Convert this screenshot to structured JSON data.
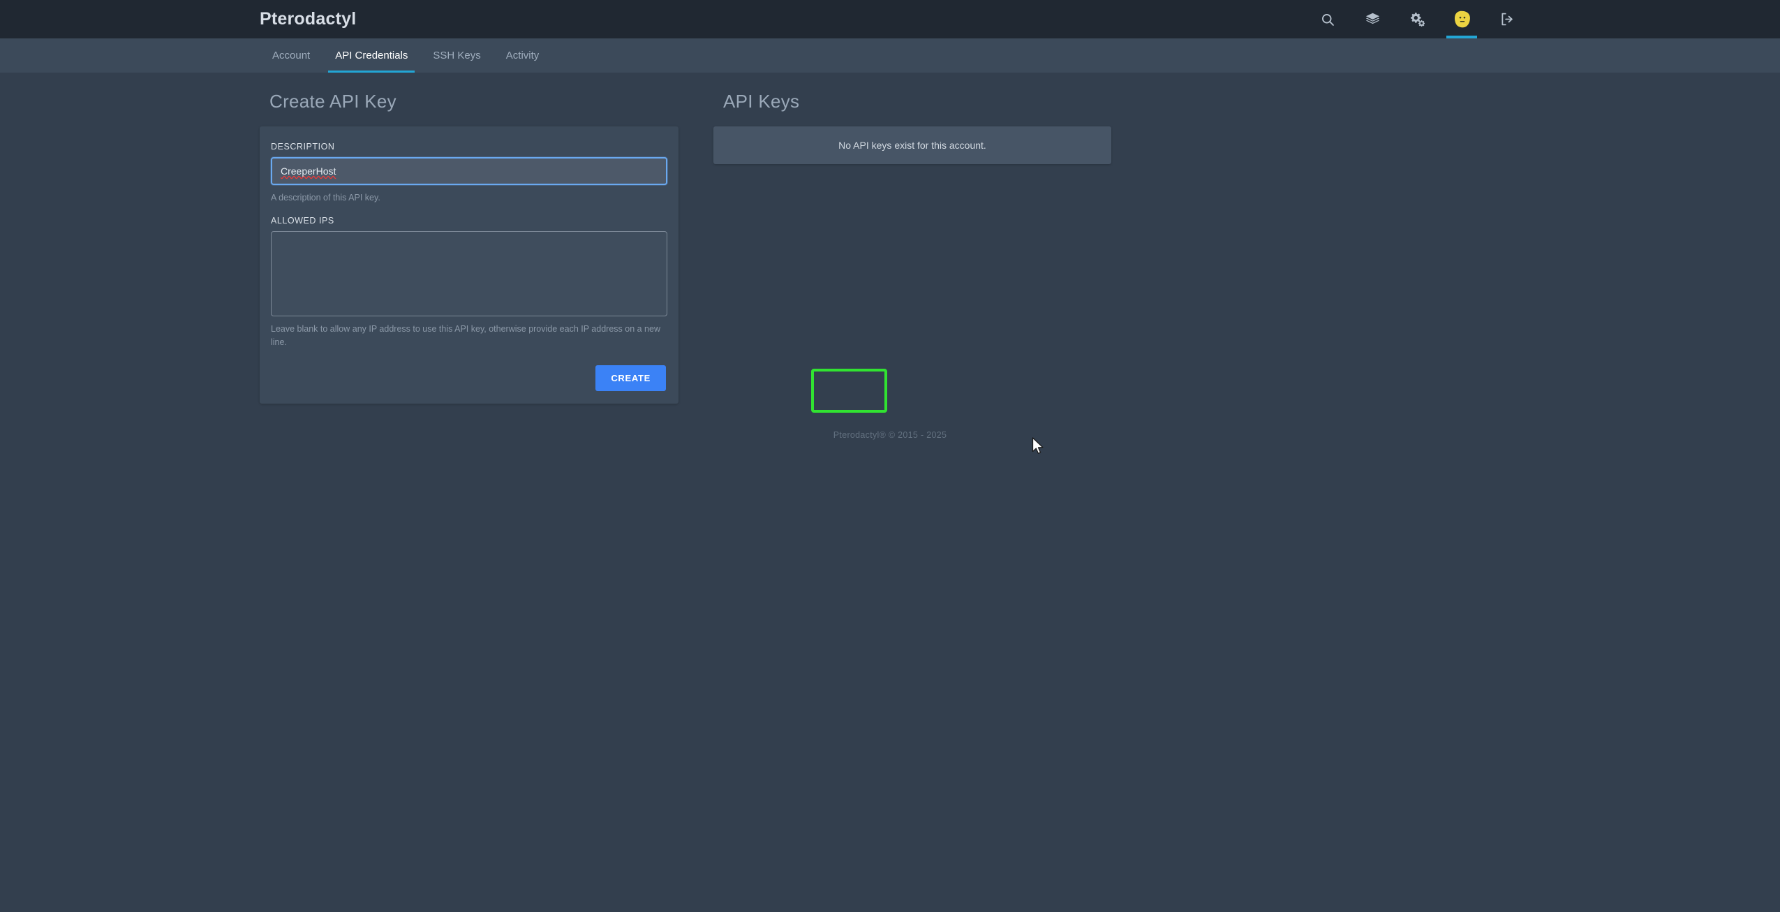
{
  "header": {
    "brand": "Pterodactyl",
    "icons": [
      {
        "name": "search-icon",
        "label": "Search"
      },
      {
        "name": "layers-icon",
        "label": "Servers"
      },
      {
        "name": "cogs-icon",
        "label": "Admin"
      },
      {
        "name": "avatar-icon",
        "label": "Account"
      },
      {
        "name": "logout-icon",
        "label": "Sign Out"
      }
    ],
    "active_icon": "avatar-icon",
    "accent_color": "#23a6d5",
    "background_color": "#202832"
  },
  "subnav": {
    "background_color": "#3c4a5a",
    "items": [
      {
        "label": "Account",
        "active": false
      },
      {
        "label": "API Credentials",
        "active": true
      },
      {
        "label": "SSH Keys",
        "active": false
      },
      {
        "label": "Activity",
        "active": false
      }
    ]
  },
  "create_api_key": {
    "title": "Create API Key",
    "description_label": "DESCRIPTION",
    "description_value": "CreeperHost",
    "description_placeholder": "",
    "description_help": "A description of this API key.",
    "allowed_ips_label": "ALLOWED IPS",
    "allowed_ips_value": "",
    "allowed_ips_placeholder": "",
    "allowed_ips_help": "Leave blank to allow any IP address to use this API key, otherwise provide each IP address on a new line.",
    "submit_label": "CREATE",
    "submit_color": "#3b82f6"
  },
  "api_keys": {
    "title": "API Keys",
    "empty_message": "No API keys exist for this account."
  },
  "highlight": {
    "color": "#31e331",
    "target": "CREATE"
  },
  "footer": {
    "text": "Pterodactyl® © 2015 - 2025"
  },
  "page": {
    "background_color": "#333f4e"
  }
}
